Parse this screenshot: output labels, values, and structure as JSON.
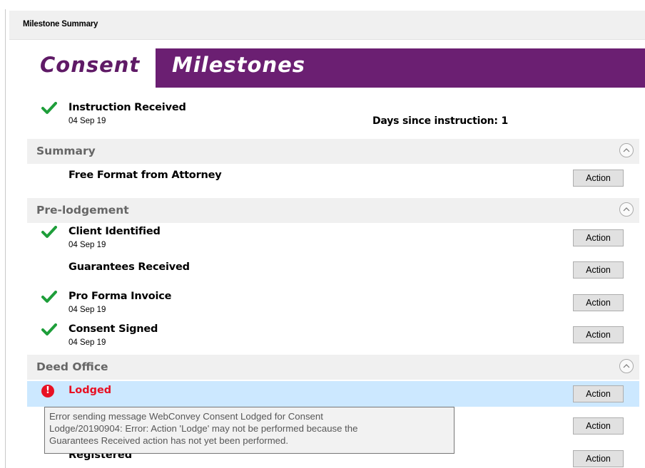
{
  "window": {
    "title": "Milestone Summary"
  },
  "banner": {
    "left": "Consent",
    "right": "Milestones"
  },
  "instruction": {
    "title": "Instruction Received",
    "date": "04 Sep 19",
    "days_since": "Days since instruction: 1"
  },
  "sections": [
    {
      "label": "Summary"
    },
    {
      "label": "Pre-lodgement"
    },
    {
      "label": "Deed Office"
    }
  ],
  "summary_items": [
    {
      "title": "Free Format from Attorney",
      "action": "Action"
    }
  ],
  "prelodgement_items": [
    {
      "title": "Client Identified",
      "date": "04 Sep 19",
      "done": true,
      "action": "Action"
    },
    {
      "title": "Guarantees Received",
      "date": "",
      "done": false,
      "action": "Action"
    },
    {
      "title": "Pro Forma Invoice",
      "date": "04 Sep 19",
      "done": true,
      "action": "Action"
    },
    {
      "title": "Consent Signed",
      "date": "04 Sep 19",
      "done": true,
      "action": "Action"
    }
  ],
  "deed_items": [
    {
      "title": "Lodged",
      "status": "error",
      "action": "Action"
    },
    {
      "title": "",
      "action": "Action"
    },
    {
      "title": "Registered",
      "action": "Action"
    }
  ],
  "tooltip": {
    "line1": "Error sending message WebConvey Consent Lodged for Consent",
    "line2": "Lodge/20190904: Error: Action 'Lodge' may not be performed because the",
    "line3": "Guarantees Received action has not yet been performed."
  },
  "colors": {
    "banner_purple": "#6b1f72",
    "check_green": "#1e9e3a",
    "error_red": "#e81123",
    "selection_blue": "#cce8ff"
  },
  "icons": {
    "check": "check-icon",
    "error": "error-icon",
    "collapse": "chevron-up-icon"
  }
}
